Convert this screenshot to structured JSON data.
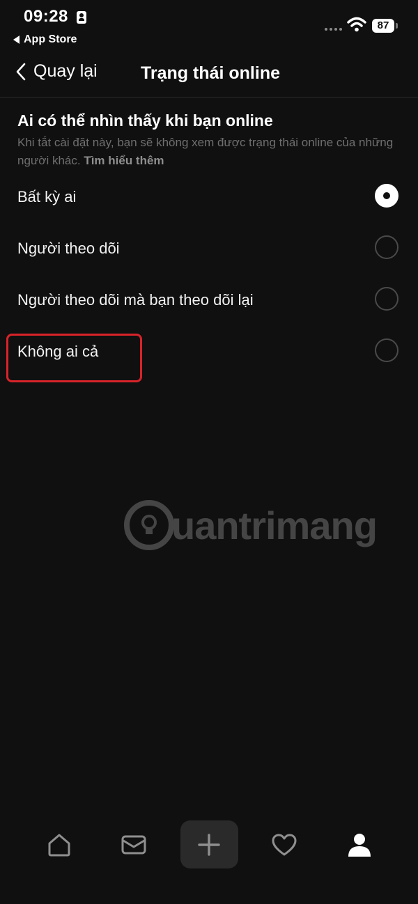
{
  "status_bar": {
    "time": "09:28",
    "back_app": "App Store",
    "battery": "87"
  },
  "nav": {
    "back_label": "Quay lại",
    "title": "Trạng thái online"
  },
  "section": {
    "title": "Ai có thể nhìn thấy khi bạn online",
    "description": "Khi tắt cài đặt này, bạn sẽ không xem được trạng thái online của những người khác.",
    "learn_more": "Tìm hiểu thêm"
  },
  "options": [
    {
      "label": "Bất kỳ ai",
      "selected": true
    },
    {
      "label": "Người theo dõi",
      "selected": false
    },
    {
      "label": "Người theo dõi mà bạn theo dõi lại",
      "selected": false
    },
    {
      "label": "Không ai cả",
      "selected": false
    }
  ],
  "watermark": {
    "text": "uantrimang"
  },
  "tabbar": {
    "items": [
      "home-icon",
      "mail-icon",
      "plus-icon",
      "heart-icon",
      "profile-icon"
    ],
    "active": "profile-icon"
  },
  "colors": {
    "background": "#101010",
    "highlight": "#d8232a",
    "muted_text": "#6f6f6f"
  }
}
